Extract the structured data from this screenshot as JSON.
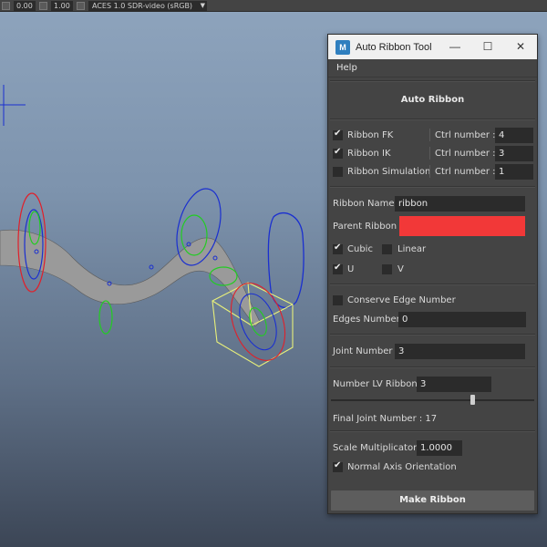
{
  "topbar": {
    "field1": "0.00",
    "field2": "1.00",
    "color_space": "ACES 1.0 SDR-video (sRGB)"
  },
  "window": {
    "title": "Auto Ribbon Tool",
    "minimize_glyph": "—",
    "maximize_glyph": "☐",
    "close_glyph": "✕",
    "menu_help": "Help",
    "header": "Auto Ribbon",
    "ribbon_fk": {
      "label": "Ribbon FK",
      "checked": true,
      "ctrl_label": "Ctrl number  :",
      "ctrl_value": "4"
    },
    "ribbon_ik": {
      "label": "Ribbon IK",
      "checked": true,
      "ctrl_label": "Ctrl number  :",
      "ctrl_value": "3"
    },
    "ribbon_sim": {
      "label": "Ribbon Simulation",
      "checked": false,
      "ctrl_label": "Ctrl number  :",
      "ctrl_value": "1"
    },
    "ribbon_name_label": "Ribbon Name :",
    "ribbon_name_value": "ribbon",
    "parent_ribbon_label": "Parent Ribbon :",
    "parent_ribbon_color": "#f23838",
    "cubic_label": "Cubic",
    "linear_label": "Linear",
    "u_label": "U",
    "v_label": "V",
    "conserve_label": "Conserve Edge Number",
    "edges_label": "Edges Number :",
    "edges_value": "0",
    "joint_label": "Joint Number :",
    "joint_value": "3",
    "lv_label": "Number LV Ribbon :",
    "lv_value": "3",
    "lv_slider_fraction": 0.7,
    "final_joint_label": "Final Joint Number :  17",
    "scale_label": "Scale Multiplicator :",
    "scale_value": "1.0000",
    "normal_axis_label": "Normal Axis Orientation",
    "make_button": "Make Ribbon"
  },
  "colors": {
    "viewport_top": "#8ea4bd",
    "viewport_bottom": "#3c4656",
    "ribbon": "#9c9c9c",
    "ctrl_red": "#e0202a",
    "ctrl_blue": "#1a2fd0",
    "ctrl_green": "#22cc22",
    "ctrl_yellow": "#e8f07a"
  }
}
